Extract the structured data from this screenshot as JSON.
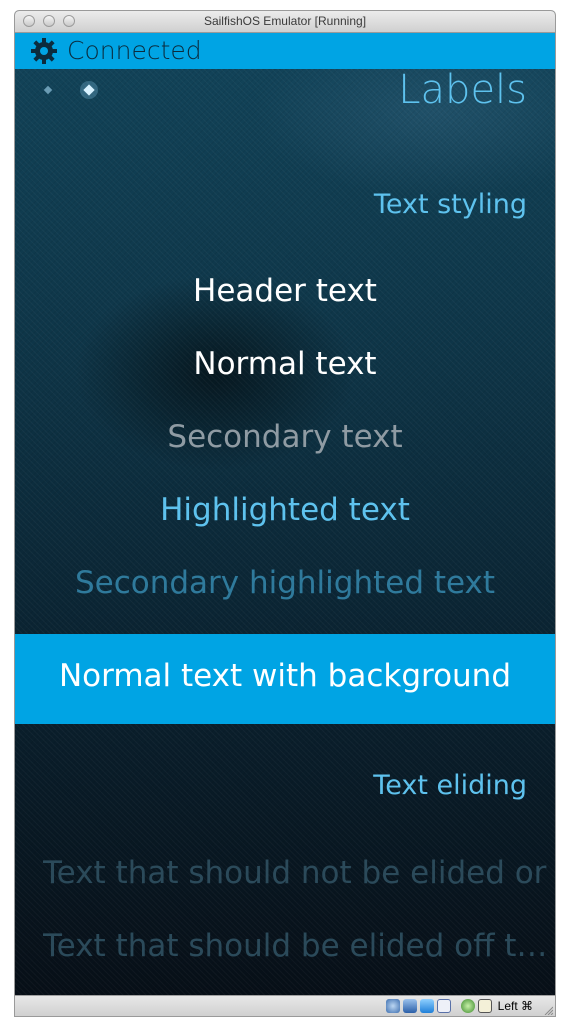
{
  "window": {
    "title": "SailfishOS Emulator [Running]"
  },
  "statusbar": {
    "text": "Connected",
    "icon": "gear-icon",
    "color": "#00a4e4"
  },
  "page": {
    "title": "Labels",
    "section_styling": "Text styling",
    "header_text": "Header text",
    "normal_text": "Normal text",
    "secondary_text": "Secondary text",
    "highlighted_text": "Highlighted text",
    "secondary_highlighted_text": "Secondary highlighted text",
    "background_text": "Normal text with background",
    "section_eliding": "Text eliding",
    "elide_fade": "Text that should not be elided or faded",
    "elide_right": "Text that should be elided off t…"
  },
  "colors": {
    "highlight": "#5ec2ee",
    "primary": "#ffffff",
    "secondary": "#8f9ba3",
    "secondary_highlight": "#2f7a9c"
  },
  "vbox_bar": {
    "host_key": "Left ⌘",
    "icons": [
      "hard-disk-icon",
      "network-icon",
      "shared-folder-icon",
      "usb-icon",
      "capture-icon",
      "mouse-integration-icon"
    ]
  }
}
